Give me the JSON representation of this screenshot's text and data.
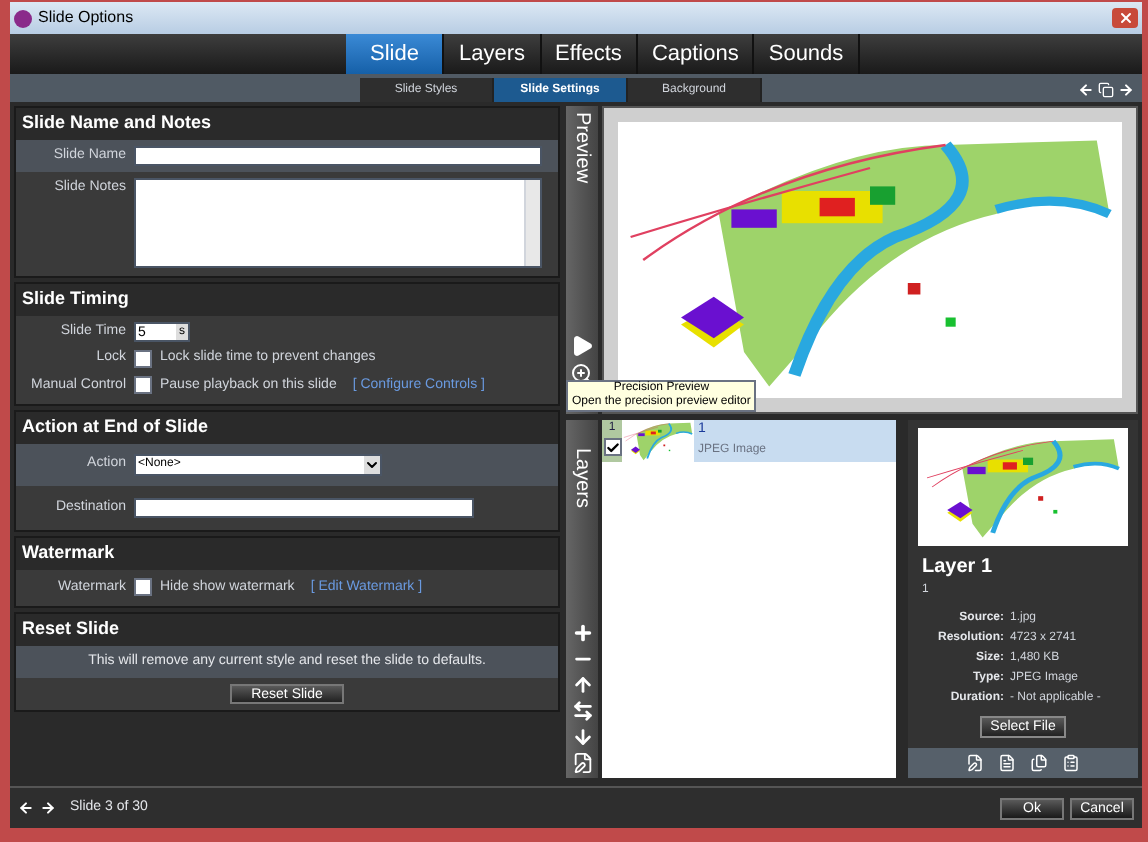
{
  "window": {
    "title": "Slide Options"
  },
  "tabs": [
    {
      "label": "Slide",
      "selected": true
    },
    {
      "label": "Layers",
      "selected": false
    },
    {
      "label": "Effects",
      "selected": false
    },
    {
      "label": "Captions",
      "selected": false
    },
    {
      "label": "Sounds",
      "selected": false
    }
  ],
  "subtabs": [
    {
      "label": "Slide Styles",
      "selected": false
    },
    {
      "label": "Slide Settings",
      "selected": true
    },
    {
      "label": "Background",
      "selected": false
    }
  ],
  "name_notes": {
    "title": "Slide Name and Notes",
    "slide_name_label": "Slide Name",
    "slide_notes_label": "Slide Notes"
  },
  "timing": {
    "title": "Slide Timing",
    "time_label": "Slide Time",
    "time_value": "5",
    "time_unit": "s",
    "lock_label": "Lock",
    "lock_text": "Lock slide time to prevent changes",
    "lock_checked": false,
    "manual_label": "Manual Control",
    "manual_text": "Pause playback on this slide",
    "manual_checked": false,
    "manual_link": "[ Configure Controls ]"
  },
  "action_end": {
    "title": "Action at End of Slide",
    "action_label": "Action",
    "action_value": "<None>",
    "destination_label": "Destination"
  },
  "watermark": {
    "title": "Watermark",
    "label": "Watermark",
    "text": "Hide show watermark",
    "checked": false,
    "link": "[ Edit Watermark ]"
  },
  "reset": {
    "title": "Reset Slide",
    "message": "This will remove any current style and reset the slide to defaults.",
    "button": "Reset Slide"
  },
  "preview": {
    "label": "Preview",
    "tooltip_title": "Precision Preview",
    "tooltip_text": "Open the precision preview editor"
  },
  "layers": {
    "label": "Layers",
    "items": [
      {
        "number": "1",
        "name": "1",
        "type": "JPEG Image",
        "checked": true,
        "selected": true
      }
    ]
  },
  "details": {
    "name": "Layer 1",
    "subtitle": "1",
    "button": "Select File",
    "props": [
      {
        "label": "Source:",
        "value": "1.jpg"
      },
      {
        "label": "Resolution:",
        "value": "4723 x 2741"
      },
      {
        "label": "Size:",
        "value": "1,480 KB"
      },
      {
        "label": "Type:",
        "value": "JPEG Image"
      },
      {
        "label": "Duration:",
        "value": "- Not applicable -"
      }
    ]
  },
  "footer": {
    "status": "Slide 3 of 30",
    "buttons": [
      "Ok",
      "Cancel"
    ]
  }
}
